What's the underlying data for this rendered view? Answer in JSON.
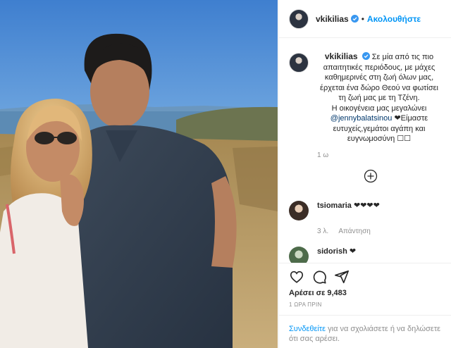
{
  "post": {
    "username": "vkikilias",
    "follow_label": "Ακολουθήστε",
    "dot": "•",
    "caption_lines": [
      "Σε μία από τις πιο",
      "απαιτητικές περιόδους, με μάχες",
      "καθημερινές στη ζωή όλων μας,",
      "έρχεται ένα δώρο Θεού να φωτίσει",
      "τη ζωή μας με τη Τζένη.",
      "Η οικογένεια μας μεγαλώνει"
    ],
    "mention": "@jennybalatsinou",
    "caption_after_mention": " ❤Είμαστε",
    "caption_tail": [
      "ευτυχείς,γεμάτοι αγάπη και",
      "ευγνωμοσύνη ☐☐"
    ],
    "caption_time": "1 ω"
  },
  "comments": [
    {
      "username": "tsiomaria",
      "text": "❤❤❤❤",
      "time": "3 λ.",
      "reply": "Απάντηση"
    },
    {
      "username": "sidorish",
      "text": "❤",
      "time": "",
      "reply": ""
    }
  ],
  "actions": {
    "likes": "Αρέσει σε 9,483",
    "time_ago": "1 ΩΡΑ ΠΡΙΝ"
  },
  "login": {
    "link": "Συνδεθείτε",
    "text": " για να σχολιάσετε ή να δηλώσετε ότι σας αρέσει."
  },
  "colors": {
    "accent": "#0095f6",
    "verified": "#3897f0",
    "muted": "#8e8e8e"
  },
  "icons": [
    "heart-icon",
    "comment-icon",
    "share-icon",
    "plus-circle-icon",
    "verified-badge-icon"
  ]
}
